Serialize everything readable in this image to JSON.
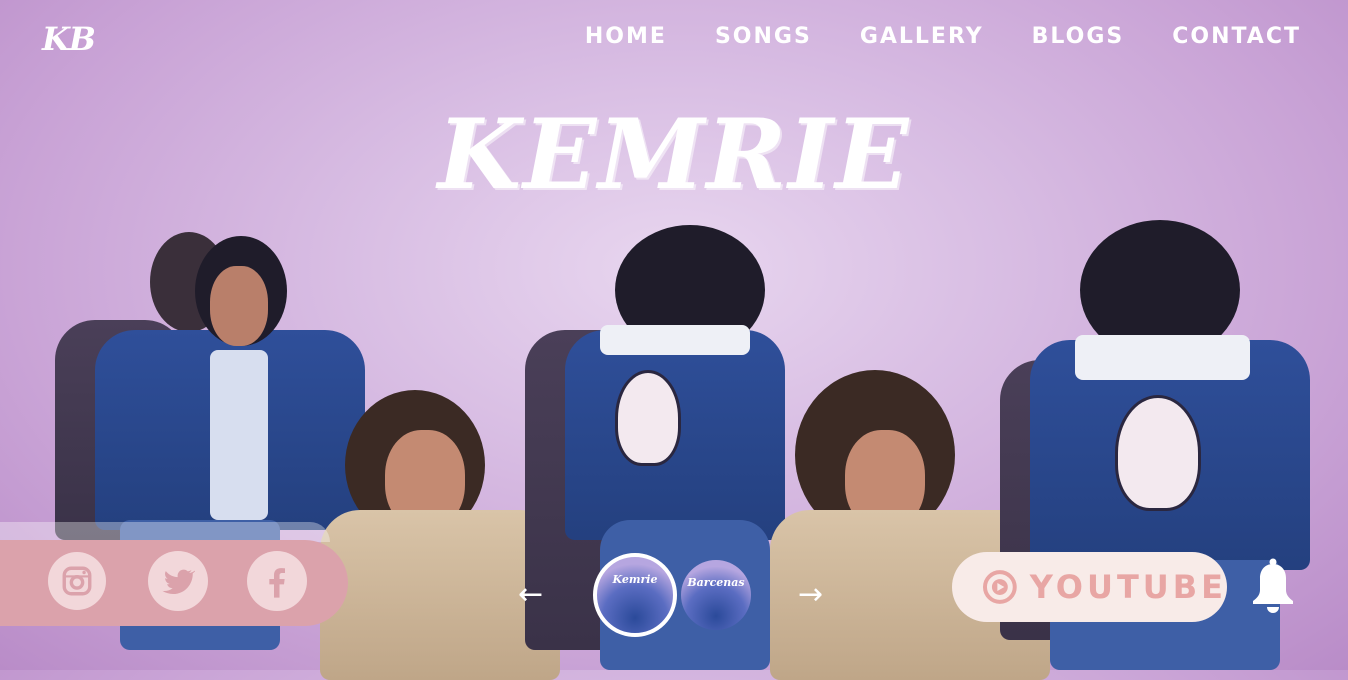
{
  "brand": {
    "logo": "KB"
  },
  "nav": {
    "items": [
      "HOME",
      "SONGS",
      "GALLERY",
      "BLOGS",
      "CONTACT"
    ]
  },
  "hero": {
    "title": "KEMRIE"
  },
  "social": {
    "icons": [
      "instagram-icon",
      "twitter-icon",
      "facebook-icon"
    ]
  },
  "carousel": {
    "prev_arrow": "←",
    "next_arrow": "→",
    "slides": [
      "Kemrie",
      "Barcenas"
    ],
    "active_index": 0
  },
  "youtube": {
    "label": "YOUTUBE",
    "icon": "youtube-play-icon"
  },
  "notify": {
    "icon": "bell-icon"
  },
  "colors": {
    "background": "#d8bde3",
    "social_panel": "#dba2ab",
    "social_button": "#f2d7da",
    "youtube_pill": "#f8ebe8",
    "youtube_text": "#e8a6a4",
    "text": "#ffffff"
  }
}
